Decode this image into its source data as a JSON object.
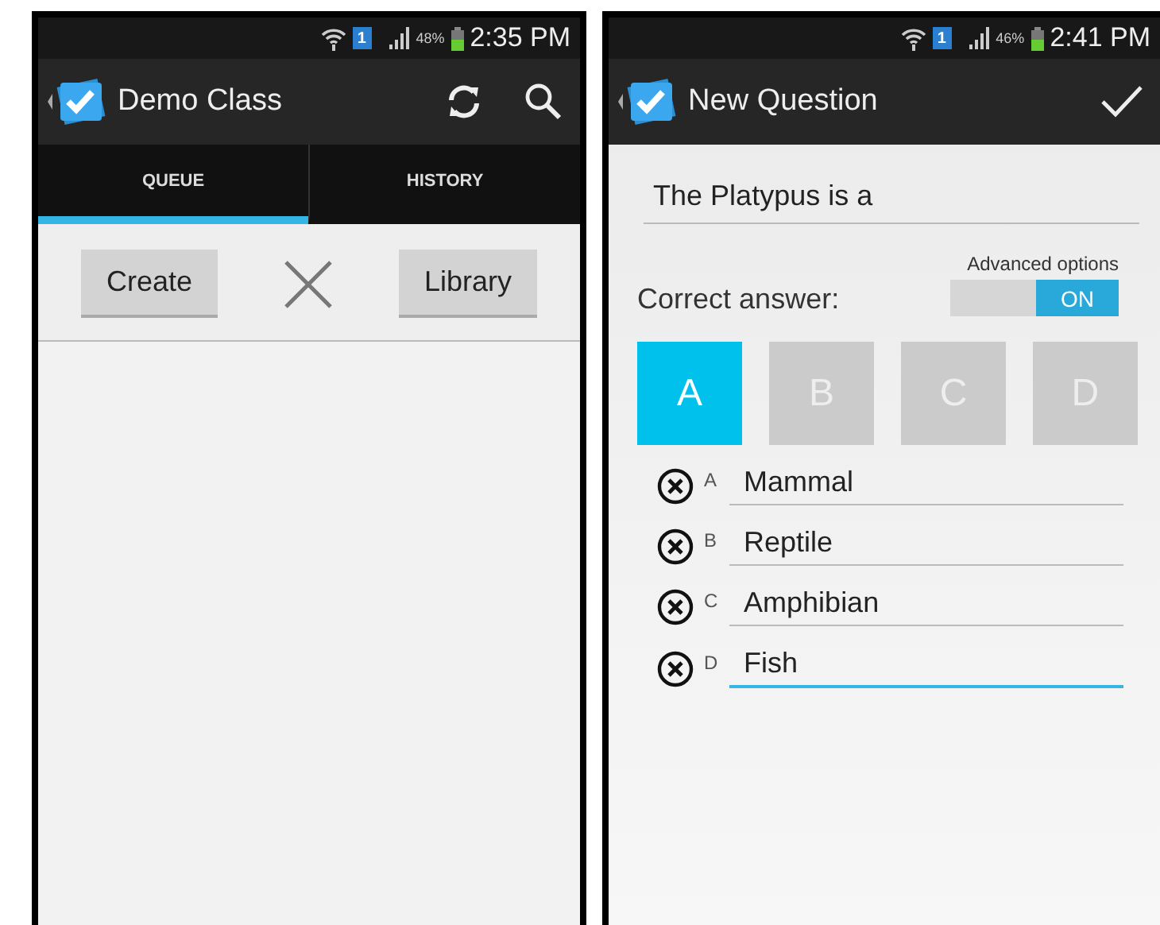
{
  "screens": [
    {
      "status_bar": {
        "sim": "1",
        "battery": "48%",
        "time": "2:35 PM"
      },
      "action_bar": {
        "title": "Demo Class",
        "actions": [
          {
            "kind": "refresh"
          },
          {
            "kind": "search"
          }
        ]
      },
      "tabs": [
        {
          "label": "QUEUE",
          "selected": true
        },
        {
          "label": "HISTORY",
          "selected": false
        }
      ],
      "toolbar": {
        "buttons": [
          "Create",
          "Library"
        ]
      },
      "kind": "queue"
    },
    {
      "status_bar": {
        "sim": "1",
        "battery": "46%",
        "time": "2:41 PM"
      },
      "action_bar": {
        "title": "New Question",
        "actions": [
          {
            "kind": "done"
          }
        ]
      },
      "kind": "question",
      "question": {
        "value": "The Platypus is a"
      },
      "advanced": {
        "label": "Advanced options",
        "switch_label": "ON",
        "on": true
      },
      "correct_label": "Correct answer:",
      "choices": [
        {
          "label": "A",
          "selected": true
        },
        {
          "label": "B",
          "selected": false
        },
        {
          "label": "C",
          "selected": false
        },
        {
          "label": "D",
          "selected": false
        }
      ],
      "answers": [
        {
          "letter": "A",
          "value": "Mammal",
          "focused": false
        },
        {
          "letter": "B",
          "value": "Reptile",
          "focused": false
        },
        {
          "letter": "C",
          "value": "Amphibian",
          "focused": false
        },
        {
          "letter": "D",
          "value": "Fish",
          "focused": true
        }
      ]
    }
  ]
}
